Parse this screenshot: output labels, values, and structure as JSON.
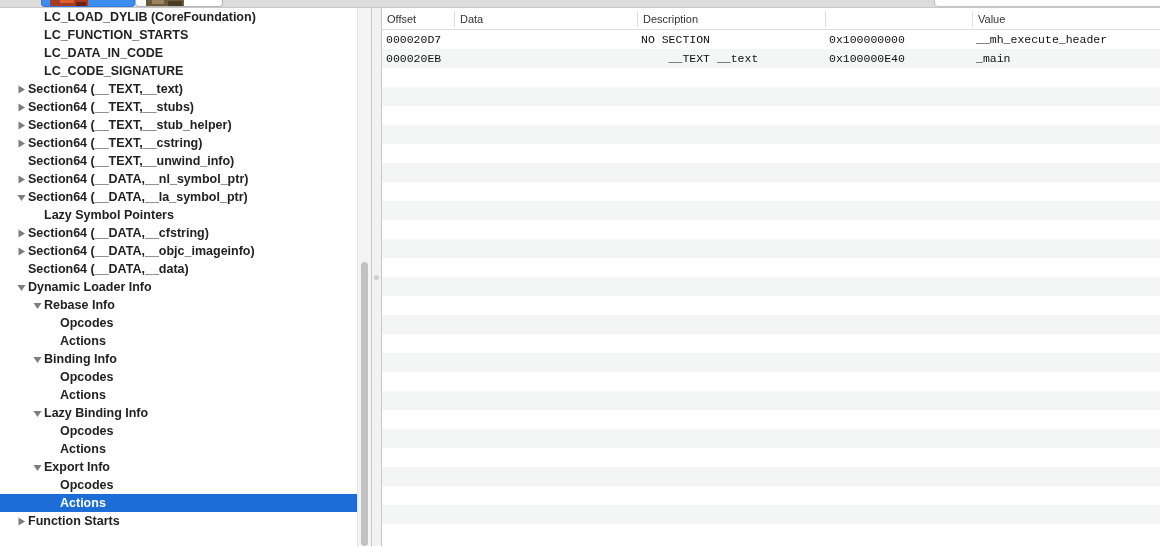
{
  "tree": {
    "items": [
      {
        "children": [
          {
            "label": "LC_LOAD_DYLIB (CoreFoundation)"
          },
          {
            "label": "LC_FUNCTION_STARTS"
          },
          {
            "label": "LC_DATA_IN_CODE"
          },
          {
            "label": "LC_CODE_SIGNATURE"
          }
        ]
      },
      {
        "label": "Section64 (__TEXT,__text)",
        "expanded": false,
        "selected": false
      },
      {
        "label": "Section64 (__TEXT,__stubs)",
        "expanded": false,
        "selected": false
      },
      {
        "label": "Section64 (__TEXT,__stub_helper)",
        "expanded": false,
        "selected": false
      },
      {
        "label": "Section64 (__TEXT,__cstring)",
        "expanded": false,
        "selected": false
      },
      {
        "label": "Section64 (__TEXT,__unwind_info)",
        "selected": false
      },
      {
        "label": "Section64 (__DATA,__nl_symbol_ptr)",
        "expanded": false,
        "selected": false
      },
      {
        "label": "Section64 (__DATA,__la_symbol_ptr)",
        "expanded": true,
        "selected": false,
        "children": [
          {
            "label": "Lazy Symbol Pointers",
            "selected": false
          }
        ]
      },
      {
        "label": "Section64 (__DATA,__cfstring)",
        "expanded": false,
        "selected": false
      },
      {
        "label": "Section64 (__DATA,__objc_imageinfo)",
        "expanded": false,
        "selected": false
      },
      {
        "label": "Section64 (__DATA,__data)",
        "selected": false
      },
      {
        "label": "Dynamic Loader Info",
        "expanded": true,
        "selected": false,
        "children": [
          {
            "label": "Rebase Info",
            "expanded": true,
            "selected": false,
            "children": [
              {
                "label": "Opcodes",
                "selected": false
              },
              {
                "label": "Actions",
                "selected": false
              }
            ]
          },
          {
            "label": "Binding Info",
            "expanded": true,
            "selected": false,
            "children": [
              {
                "label": "Opcodes",
                "selected": false
              },
              {
                "label": "Actions",
                "selected": false
              }
            ]
          },
          {
            "label": "Lazy Binding Info",
            "expanded": true,
            "selected": false,
            "children": [
              {
                "label": "Opcodes",
                "selected": false
              },
              {
                "label": "Actions",
                "selected": false
              }
            ]
          },
          {
            "label": "Export Info",
            "expanded": true,
            "selected": false,
            "children": [
              {
                "label": "Opcodes",
                "selected": false
              },
              {
                "label": "Actions",
                "selected": true
              }
            ]
          }
        ]
      },
      {
        "label": "Function Starts",
        "expanded": false,
        "selected": false
      }
    ]
  },
  "table": {
    "columns": [
      "Offset",
      "Data",
      "Description",
      "",
      "Value"
    ],
    "rows": [
      [
        "000020D7",
        "",
        "NO SECTION",
        "0x100000000",
        "__mh_execute_header"
      ],
      [
        "000020EB",
        "",
        "    __TEXT __text",
        "0x100000E40",
        "_main"
      ]
    ]
  }
}
